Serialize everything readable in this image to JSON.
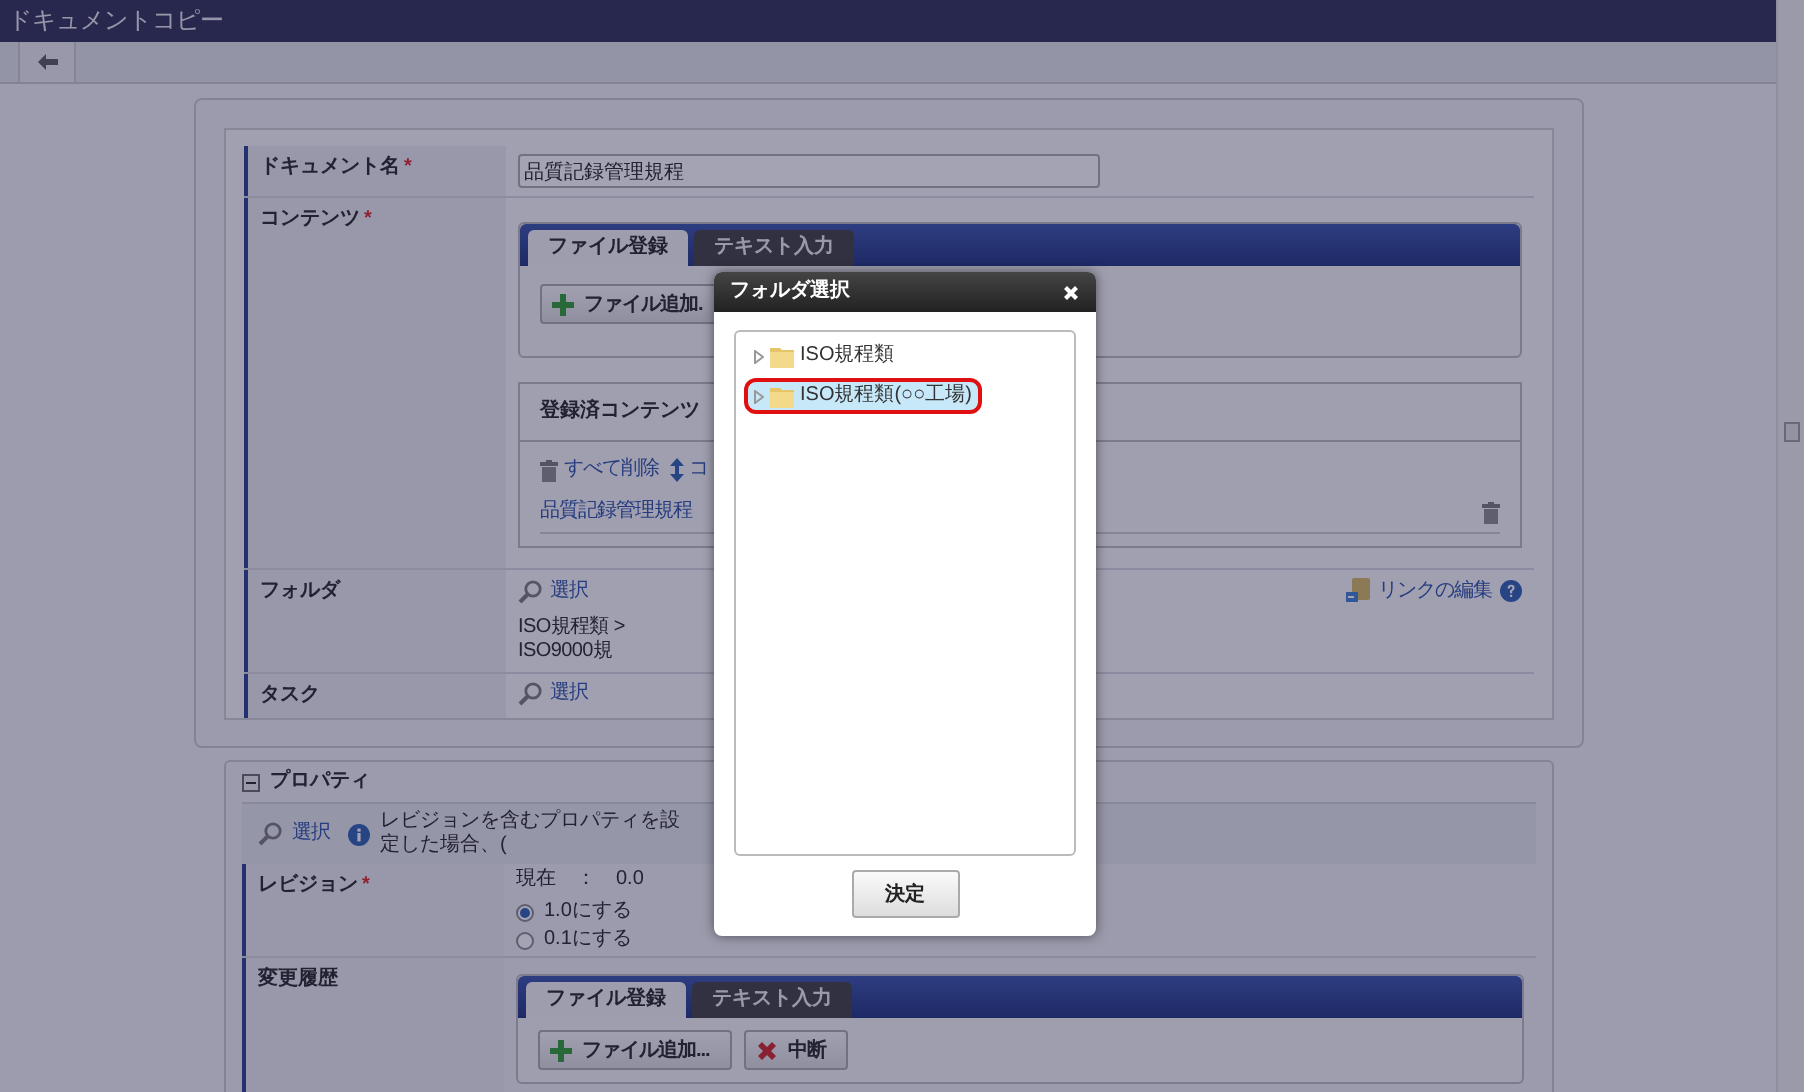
{
  "window": {
    "title": "ドキュメントコピー"
  },
  "document_name": {
    "label": "ドキュメント名",
    "required_mark": "*",
    "value": "品質記録管理規程"
  },
  "contents": {
    "label": "コンテンツ",
    "required_mark": "*",
    "tabs": [
      {
        "label": "ファイル登録",
        "selected": true
      },
      {
        "label": "テキスト入力",
        "selected": false
      }
    ],
    "add_button": "ファイル追加.",
    "registered": {
      "title": "登録済コンテンツ",
      "delete_all": "すべて削除",
      "sort_link": "コ",
      "files": [
        "品質記録管理規程"
      ]
    }
  },
  "folder": {
    "label": "フォルダ",
    "select_link": "選択",
    "path": "ISO規程類 > ISO9000規",
    "edit_link": "リンクの編集"
  },
  "task": {
    "label": "タスク",
    "select_link": "選択"
  },
  "properties": {
    "title": "プロパティ",
    "expanded": true,
    "select_link": "選択",
    "info": "レビジョンを含むプロパティを設定した場合、(",
    "revision": {
      "label": "レビジョン",
      "required_mark": "*",
      "current_label": "現在",
      "separator": "：",
      "current": "0.0",
      "options": [
        {
          "label": "1.0にする",
          "selected": true
        },
        {
          "label": "0.1にする",
          "selected": false
        }
      ]
    },
    "history": {
      "label": "変更履歴",
      "tabs": [
        {
          "label": "ファイル登録",
          "selected": true
        },
        {
          "label": "テキスト入力",
          "selected": false
        }
      ],
      "buttons": [
        {
          "kind": "add",
          "label": "ファイル追加..."
        },
        {
          "kind": "cancel",
          "label": "中断"
        }
      ]
    }
  },
  "dialog": {
    "title": "フォルダ選択",
    "tree": [
      {
        "label": "ISO規程類",
        "selected": false,
        "marked": false
      },
      {
        "label": "ISO規程類(○○工場)",
        "selected": true,
        "marked": true
      }
    ],
    "ok_button": "決定"
  }
}
